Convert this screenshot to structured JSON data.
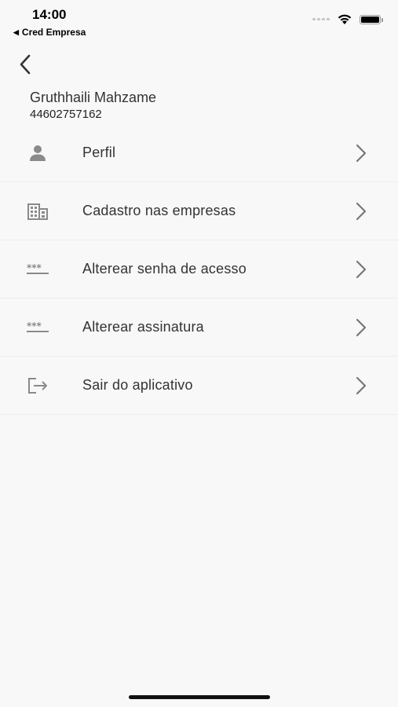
{
  "status_bar": {
    "time": "14:00",
    "back_app_label": "Cred Empresa",
    "icons": [
      "signal-icon",
      "wifi-icon",
      "battery-icon"
    ]
  },
  "nav": {
    "back_icon": "chevron-left-icon"
  },
  "profile": {
    "name": "Gruthhaili Mahzame",
    "id_number": "44602757162"
  },
  "menu": {
    "items": [
      {
        "label": "Perfil",
        "icon": "person-icon"
      },
      {
        "label": "Cadastro nas empresas",
        "icon": "building-icon"
      },
      {
        "label": "Alterear senha de acesso",
        "icon": "password-icon"
      },
      {
        "label": "Alterear assinatura",
        "icon": "password-icon"
      },
      {
        "label": "Sair do aplicativo",
        "icon": "logout-icon"
      }
    ],
    "chevron_icon": "chevron-right-icon"
  },
  "colors": {
    "background": "#f8f8f8",
    "icon_gray": "#8a8a8a",
    "divider": "#ececec",
    "text": "#333333"
  }
}
